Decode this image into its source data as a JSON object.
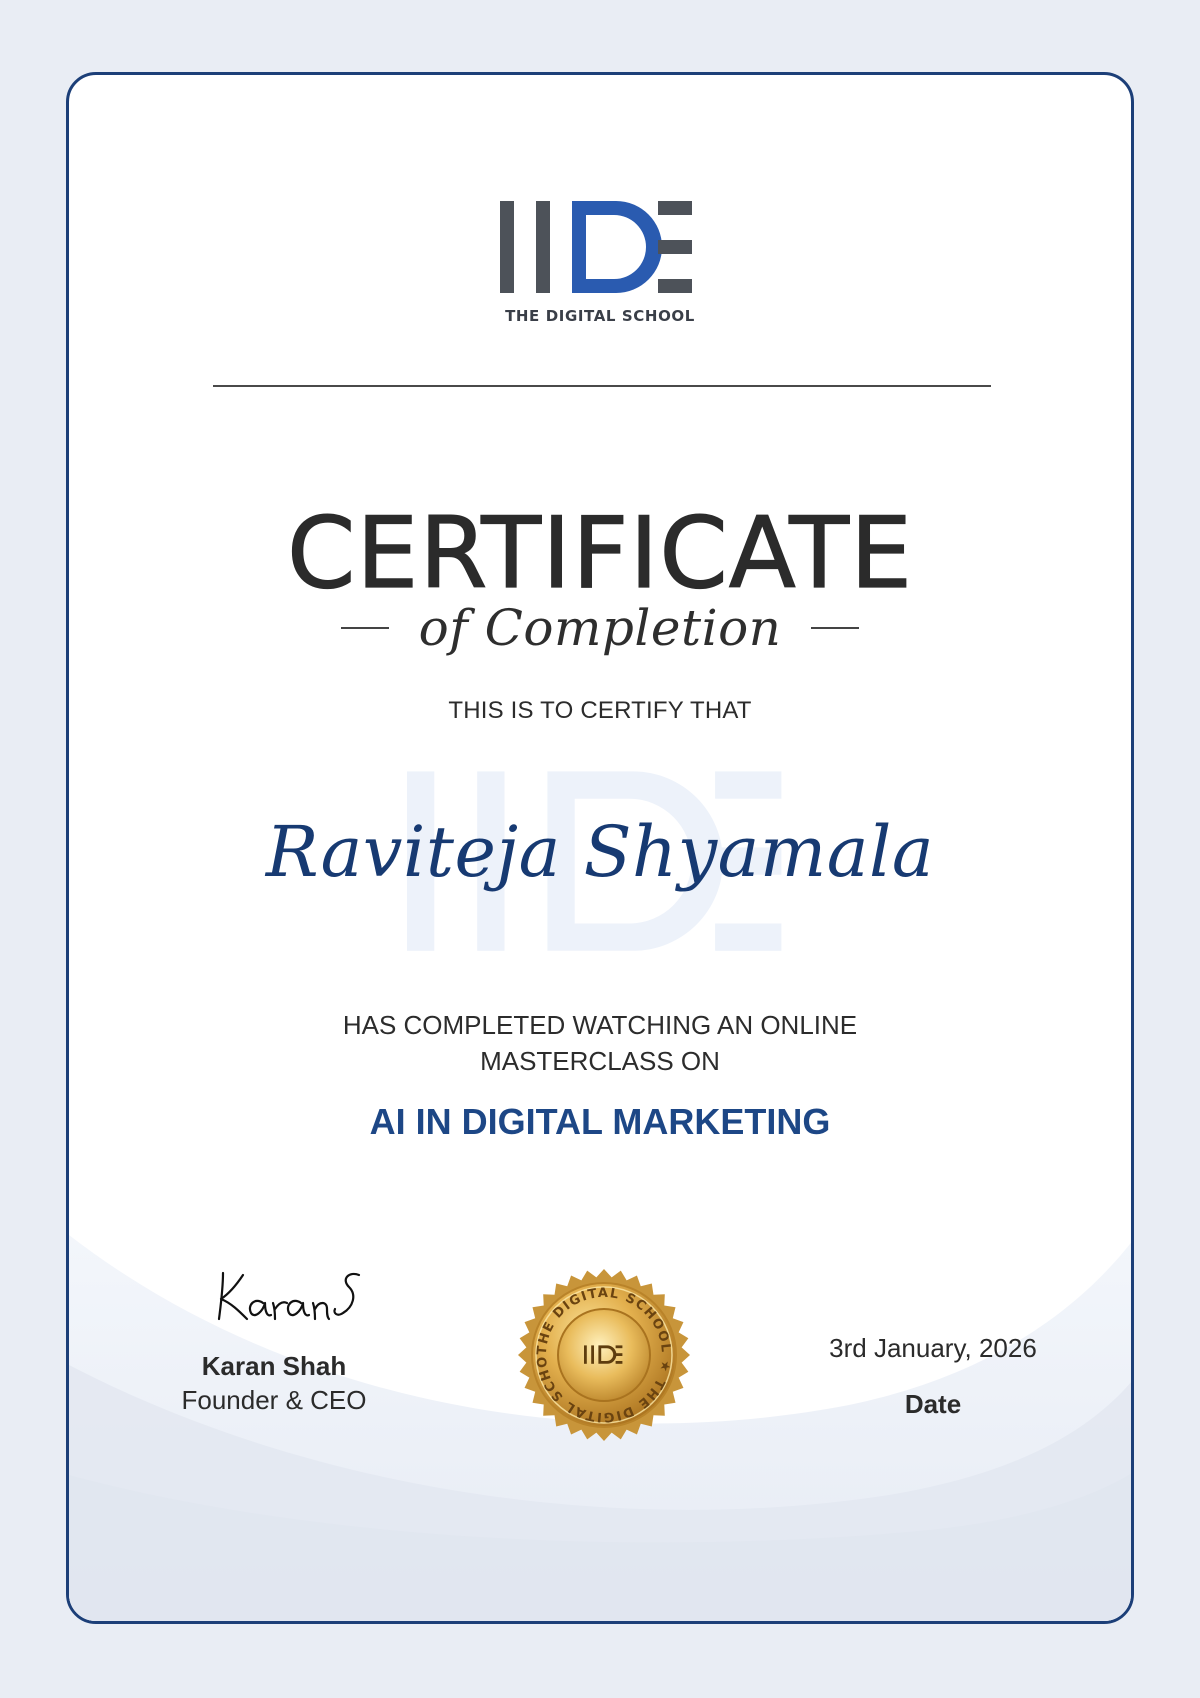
{
  "logo": {
    "name": "IIDE",
    "tagline": "THE DIGITAL SCHOOL",
    "colors": {
      "dark": "#4d5259",
      "accent": "#2a5bb0"
    }
  },
  "certificate": {
    "title": "CERTIFICATE",
    "subtitle": "of Completion",
    "certify_line": "THIS IS TO CERTIFY THAT",
    "recipient_name": "Raviteja Shyamala",
    "completed_line_1": "HAS COMPLETED WATCHING AN ONLINE",
    "completed_line_2": "MASTERCLASS ON",
    "course_title": "AI IN DIGITAL MARKETING"
  },
  "signatory": {
    "signature_text": "Karan S",
    "name": "Karan Shah",
    "role": "Founder & CEO"
  },
  "seal": {
    "ring_text": "THE DIGITAL SCHOOL ★ THE DIGITAL SCHOOL ★",
    "center_text": "IIDE",
    "color_gold": "#d5a43c"
  },
  "date": {
    "value": "3rd January, 2026",
    "label": "Date"
  },
  "colors": {
    "page_background": "#e9edf4",
    "frame_border": "#1c3f78",
    "name_color": "#173a72",
    "course_color": "#1d4786"
  }
}
